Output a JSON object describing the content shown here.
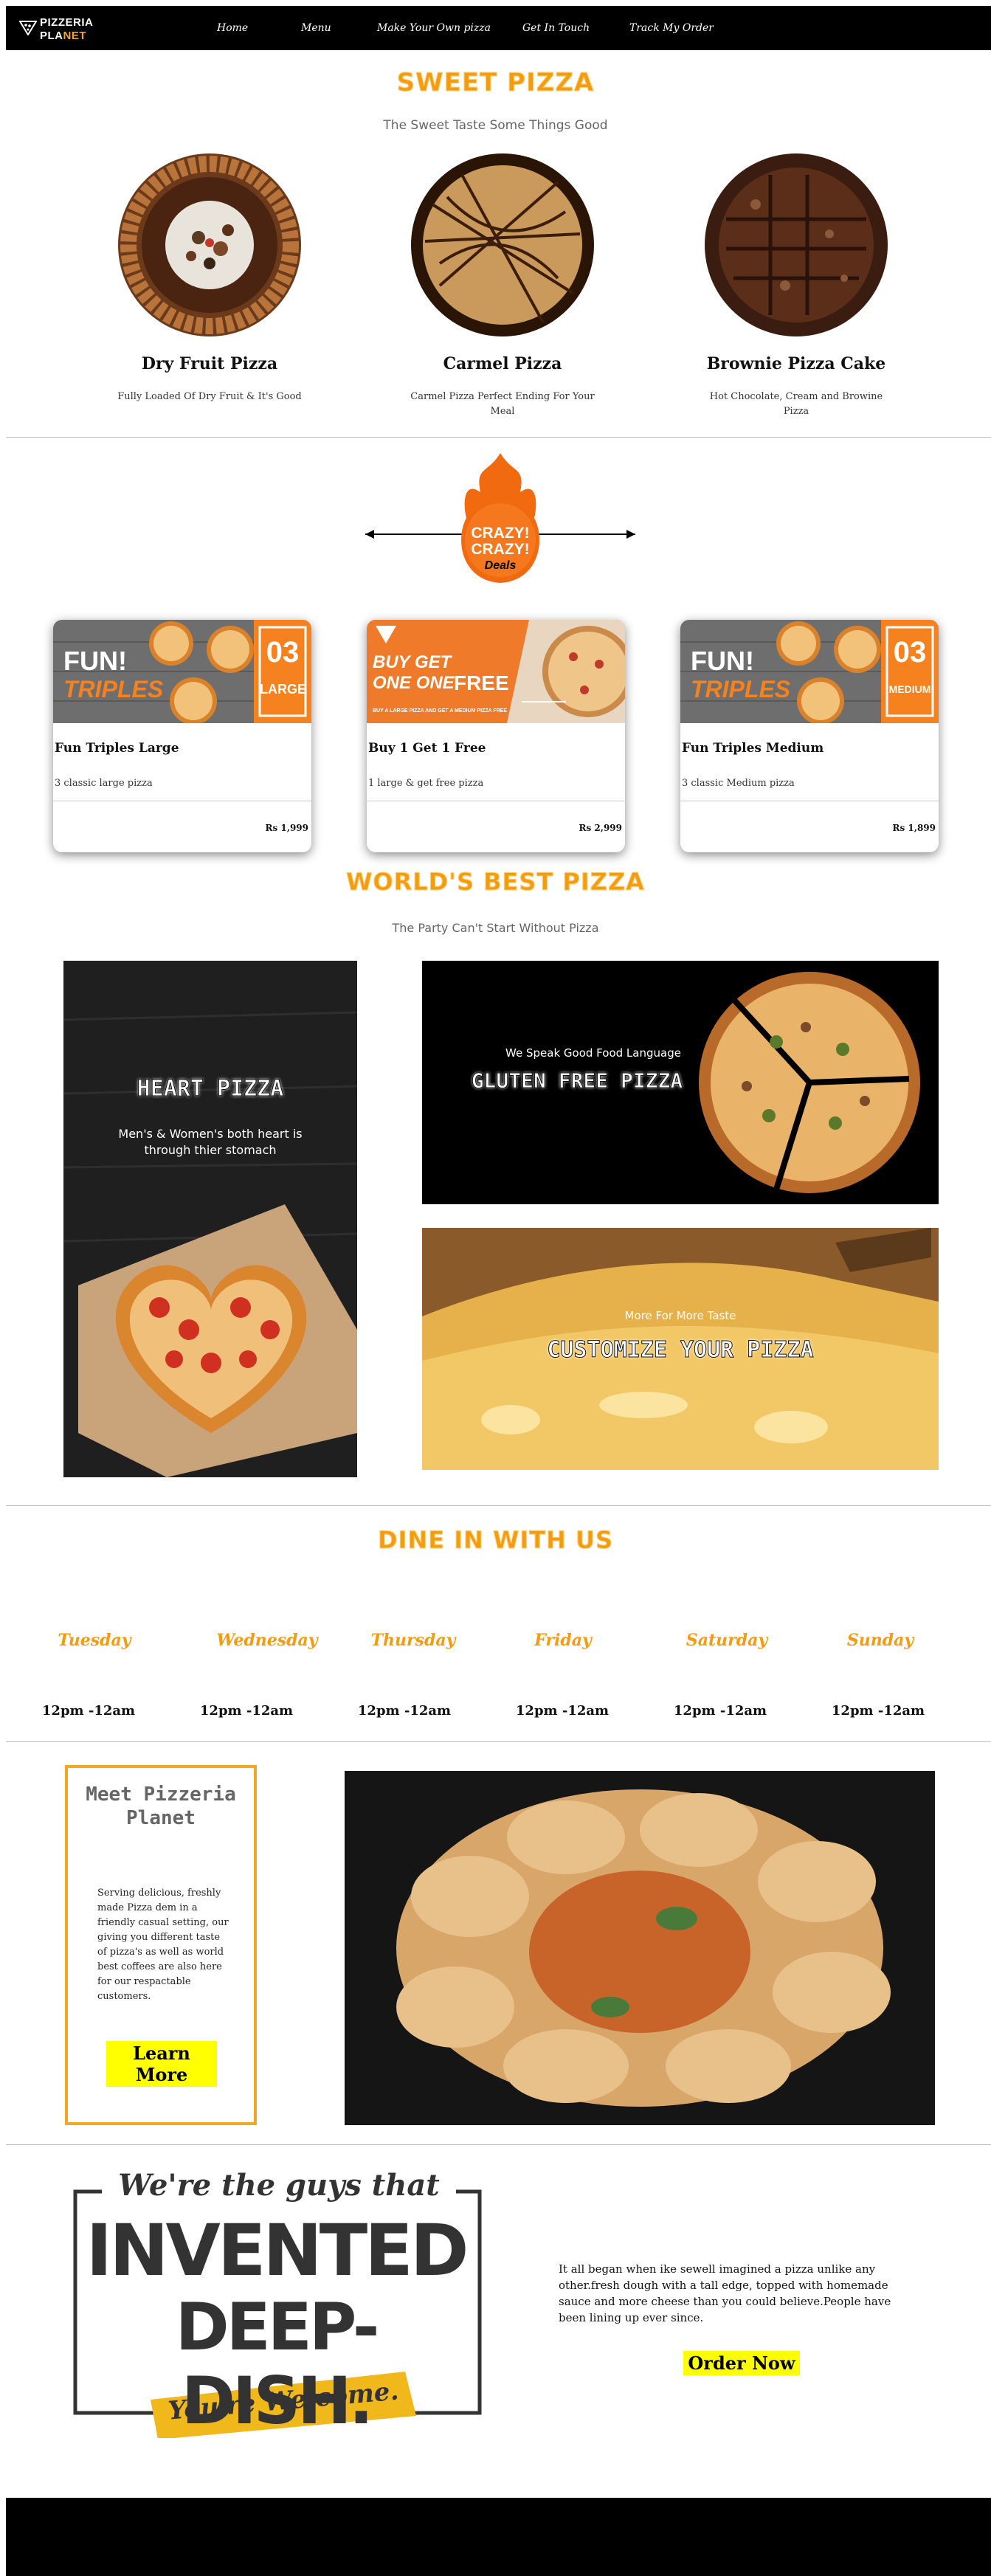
{
  "nav": {
    "logo_line1": "PIZZERIA",
    "logo_line2a": "PLA",
    "logo_line2b": "NET",
    "links": [
      "Home",
      "Menu",
      "Make Your Own pizza",
      "Get In Touch",
      "Track My Order"
    ]
  },
  "sweet": {
    "heading": "SWEET PIZZA",
    "subtitle": "The Sweet Taste Some Things Good",
    "items": [
      {
        "title": "Dry Fruit Pizza",
        "desc": "Fully Loaded Of Dry Fruit & It's Good"
      },
      {
        "title": "Carmel Pizza",
        "desc": "Carmel Pizza Perfect Ending For Your Meal"
      },
      {
        "title": "Brownie Pizza Cake",
        "desc": "Hot Chocolate, Cream and Browine Pizza"
      }
    ]
  },
  "deals_logo": {
    "line1": "CRAZY!",
    "line2": "CRAZY!",
    "line3": "Deals"
  },
  "deals": [
    {
      "title": "Fun Triples Large",
      "desc": "3 classic large pizza",
      "price": "Rs 1,999",
      "banner_a": "FUN!",
      "banner_b": "TRIPLES",
      "num": "03",
      "size": "LARGE"
    },
    {
      "title": "Buy 1 Get 1 Free",
      "desc": "1 large & get free pizza",
      "price": "Rs 2,999",
      "banner_a": "BUY GET",
      "banner_b": "ONE ONE",
      "free": "FREE",
      "small": "BUY A LARGE PIZZA AND GET A MEDIUM PIZZA FREE"
    },
    {
      "title": "Fun Triples Medium",
      "desc": "3 classic Medium pizza",
      "price": "Rs 1,899",
      "banner_a": "FUN!",
      "banner_b": "TRIPLES",
      "num": "03",
      "size": "MEDIUM"
    }
  ],
  "best": {
    "heading": "WORLD'S BEST PIZZA",
    "subtitle": "The Party Can't Start Without Pizza",
    "heart_title": "HEART PIZZA",
    "heart_sub": "Men's & Women's both heart is through thier stomach",
    "gluten_sub": "We Speak Good Food Language",
    "gluten_title": "GLUTEN FREE PIZZA",
    "custom_sub": "More For More Taste",
    "custom_title": "CUSTOMIZE YOUR PIZZA"
  },
  "dine": {
    "heading": "DINE IN WITH US",
    "days": [
      "Tuesday",
      "Wednesday",
      "Thursday",
      "Friday",
      "Saturday",
      "Sunday"
    ],
    "times": [
      "12pm -12am",
      "12pm -12am",
      "12pm -12am",
      "12pm -12am",
      "12pm -12am",
      "12pm -12am"
    ]
  },
  "meet": {
    "title": "Meet Pizzeria Planet",
    "text": "Serving delicious, freshly made Pizza dem in a friendly casual setting, our giving you different taste of pizza's as well as world best coffees are also here for our respactable customers.",
    "button": "Learn More"
  },
  "deepdish": {
    "line1": "We're the guys that",
    "line2": "INVENTED",
    "line3": "DEEP-DISH.",
    "line4": "You're Welcome.",
    "text": "It all began when ike sewell imagined a pizza unlike any other.fresh dough with a tall edge, topped with homemade sauce and more cheese than you could believe.People have been lining up ever since.",
    "button": "Order Now"
  },
  "colors": {
    "accent": "#f39c12",
    "button_bg": "#ffff00",
    "nav_bg": "#000000"
  }
}
